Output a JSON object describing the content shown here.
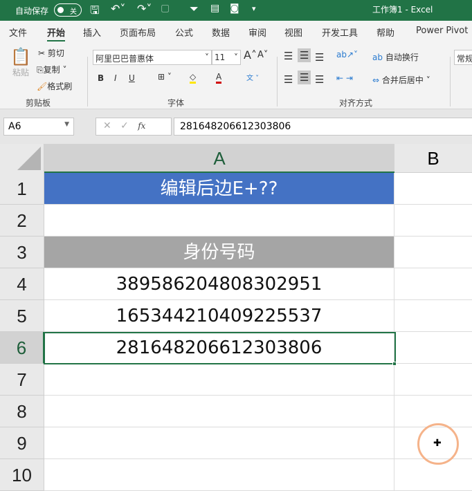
{
  "titlebar": {
    "autosave_label": "自动保存",
    "autosave_state": "关",
    "title": "工作簿1  -  Excel"
  },
  "tabs": [
    "文件",
    "开始",
    "插入",
    "页面布局",
    "公式",
    "数据",
    "审阅",
    "视图",
    "开发工具",
    "帮助",
    "Power Pivot"
  ],
  "ribbon": {
    "clipboard": {
      "paste": "粘贴",
      "cut": "剪切",
      "copy": "复制",
      "format_painter": "格式刷",
      "label": "剪贴板"
    },
    "font": {
      "font_name": "阿里巴巴普惠体",
      "font_size": "11",
      "bold": "B",
      "italic": "I",
      "underline": "U",
      "label": "字体"
    },
    "alignment": {
      "wrap": "自动换行",
      "merge": "合并后居中",
      "label": "对齐方式"
    },
    "number": {
      "format": "常规"
    }
  },
  "formula_bar": {
    "name_box": "A6",
    "fx": "fx",
    "value": "281648206612303806"
  },
  "columns": [
    "A",
    "B"
  ],
  "rows": [
    {
      "num": "1",
      "a": "编辑后边E+??"
    },
    {
      "num": "2",
      "a": ""
    },
    {
      "num": "3",
      "a": "身份号码"
    },
    {
      "num": "4",
      "a": "389586204808302951"
    },
    {
      "num": "5",
      "a": "165344210409225537"
    },
    {
      "num": "6",
      "a": "281648206612303806"
    },
    {
      "num": "7",
      "a": ""
    },
    {
      "num": "8",
      "a": ""
    },
    {
      "num": "9",
      "a": ""
    },
    {
      "num": "10",
      "a": ""
    }
  ],
  "colors": {
    "excel_green": "#217346",
    "header_blue": "#4472c4",
    "header_gray": "#a5a5a5"
  }
}
